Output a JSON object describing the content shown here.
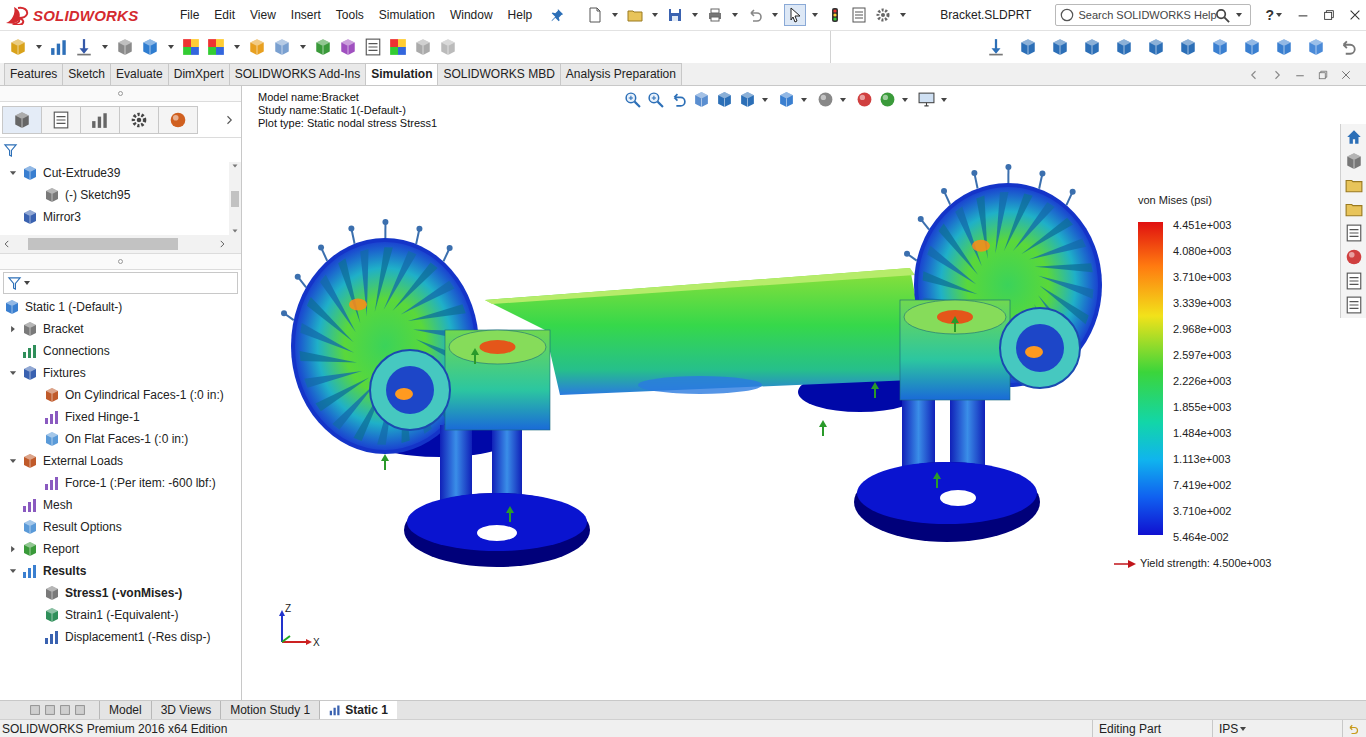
{
  "app": {
    "logo": "SOLIDWORKS",
    "document": "Bracket.SLDPRT",
    "help": "?"
  },
  "menu": [
    "File",
    "Edit",
    "View",
    "Insert",
    "Tools",
    "Simulation",
    "Window",
    "Help"
  ],
  "search": {
    "placeholder": "Search SOLIDWORKS Help"
  },
  "command_tabs": [
    {
      "label": "Features",
      "selected": false
    },
    {
      "label": "Sketch",
      "selected": false
    },
    {
      "label": "Evaluate",
      "selected": false
    },
    {
      "label": "DimXpert",
      "selected": false
    },
    {
      "label": "SOLIDWORKS Add-Ins",
      "selected": false
    },
    {
      "label": "Simulation",
      "selected": true
    },
    {
      "label": "SOLIDWORKS MBD",
      "selected": false
    },
    {
      "label": "Analysis Preparation",
      "selected": false
    }
  ],
  "feature_tree": [
    {
      "label": "Cut-Extrude39",
      "expanded": true,
      "children": [
        {
          "label": "(-) Sketch95"
        }
      ]
    },
    {
      "label": "Mirror3"
    }
  ],
  "study_tree": {
    "label": "Static 1 (-Default-)",
    "bold": false,
    "children": [
      {
        "label": "Bracket",
        "expanded": false,
        "bold": false
      },
      {
        "label": "Connections",
        "bold": false
      },
      {
        "label": "Fixtures",
        "expanded": true,
        "bold": false,
        "children": [
          {
            "label": "On Cylindrical Faces-1 (:0 in:)",
            "bold": false
          },
          {
            "label": "Fixed Hinge-1",
            "bold": false
          },
          {
            "label": "On Flat Faces-1 (:0 in:)",
            "bold": false
          }
        ]
      },
      {
        "label": "External Loads",
        "expanded": true,
        "bold": false,
        "children": [
          {
            "label": "Force-1 (:Per item: -600 lbf:)",
            "bold": false
          }
        ]
      },
      {
        "label": "Mesh",
        "bold": false
      },
      {
        "label": "Result Options",
        "bold": false
      },
      {
        "label": "Report",
        "expanded": false,
        "bold": false
      },
      {
        "label": "Results",
        "expanded": true,
        "bold": true,
        "children": [
          {
            "label": "Stress1 (-vonMises-)",
            "bold": true
          },
          {
            "label": "Strain1 (-Equivalent-)",
            "bold": false
          },
          {
            "label": "Displacement1 (-Res disp-)",
            "bold": false
          }
        ]
      }
    ]
  },
  "graphics": {
    "info": [
      "Model name:Bracket",
      "Study name:Static 1(-Default-)",
      "Plot type: Static nodal stress Stress1"
    ],
    "legend": {
      "title": "von Mises (psi)",
      "ticks": [
        "4.451e+003",
        "4.080e+003",
        "3.710e+003",
        "3.339e+003",
        "2.968e+003",
        "2.597e+003",
        "2.226e+003",
        "1.855e+003",
        "1.484e+003",
        "1.113e+003",
        "7.419e+002",
        "3.710e+002",
        "5.464e-002"
      ],
      "yield": "Yield strength: 4.500e+003"
    },
    "triad": {
      "vertical": "Z",
      "horizontal": "X"
    }
  },
  "bottom_tabs": [
    {
      "label": "Model",
      "selected": false
    },
    {
      "label": "3D Views",
      "selected": false
    },
    {
      "label": "Motion Study 1",
      "selected": false
    },
    {
      "label": "Static 1",
      "selected": true
    }
  ],
  "status_bar": {
    "edition": "SOLIDWORKS Premium 2016 x64 Edition",
    "mode": "Editing Part",
    "units": "IPS"
  }
}
